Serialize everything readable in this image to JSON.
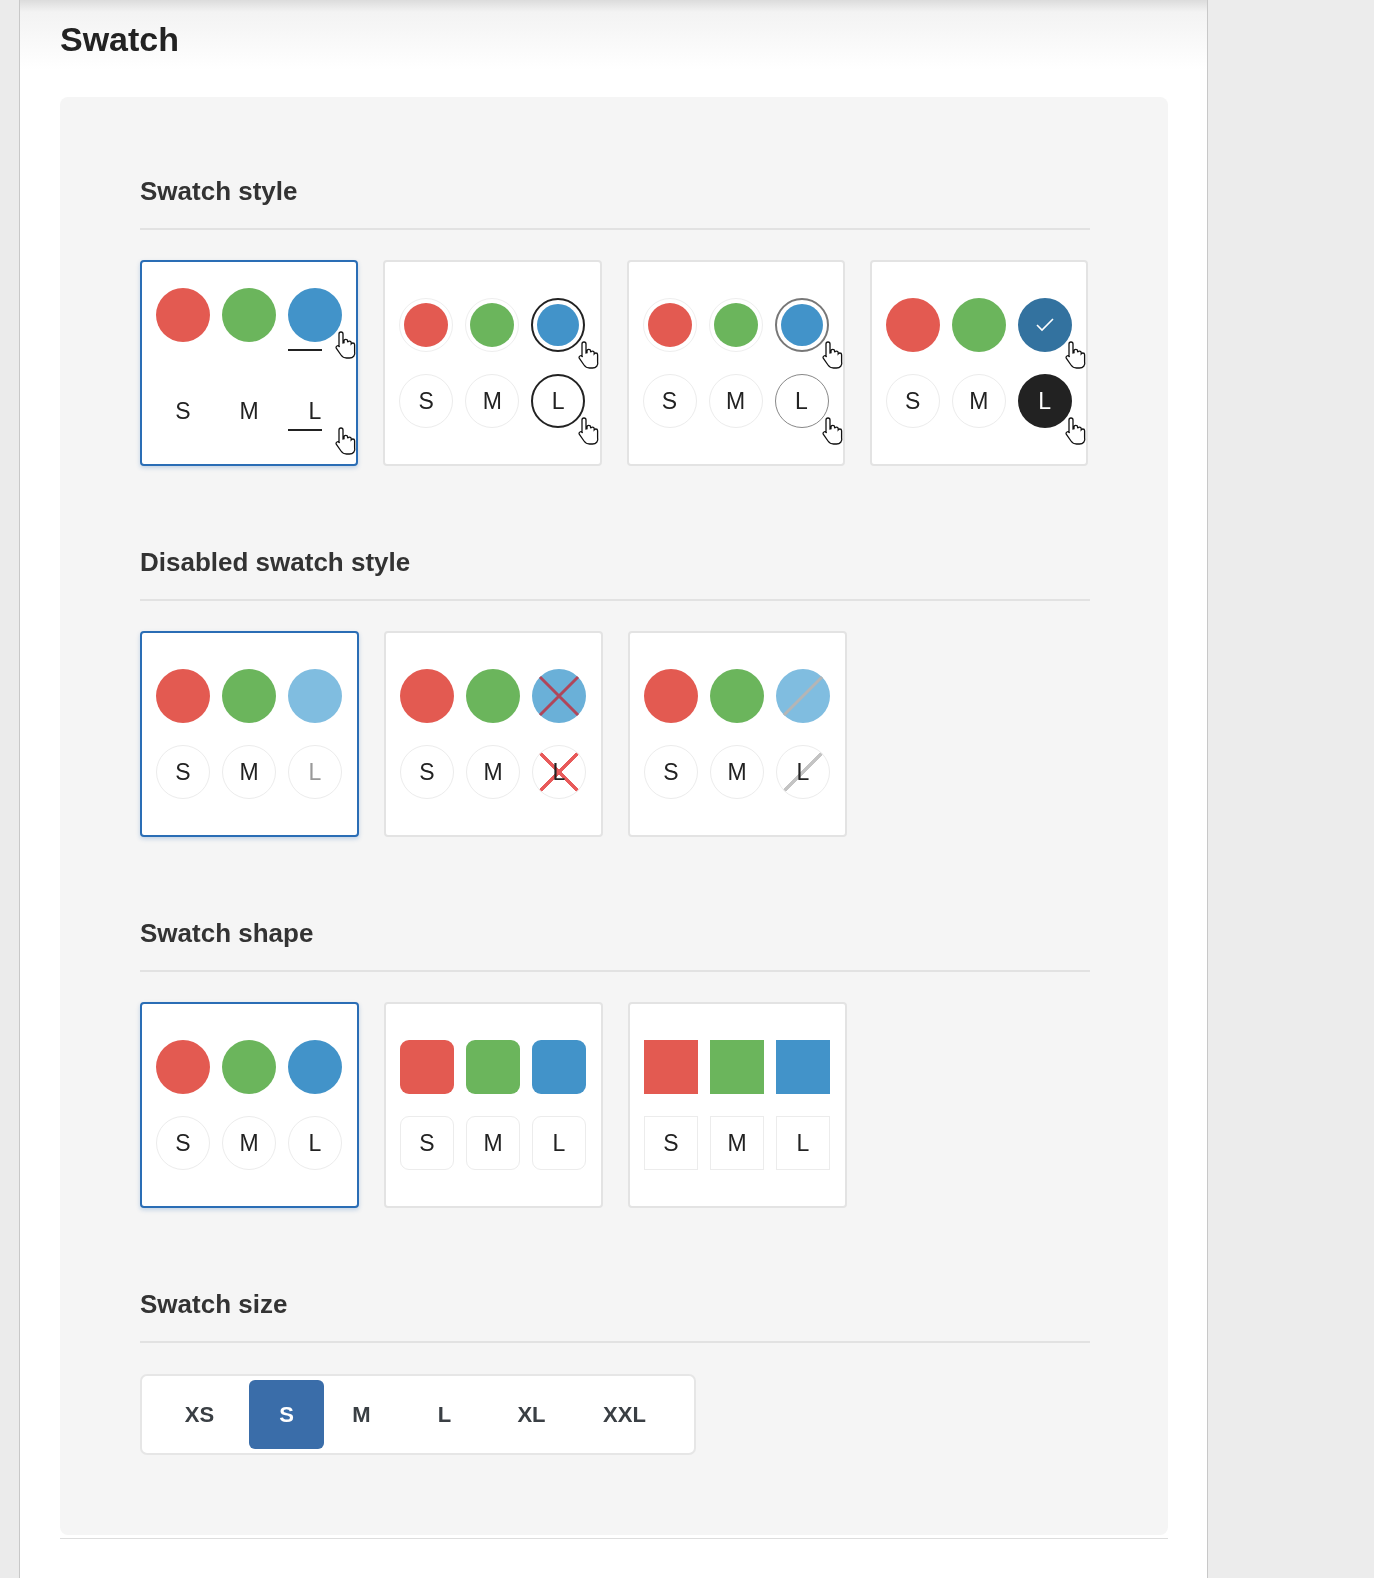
{
  "title": "Swatch",
  "sections": [
    {
      "heading": "Swatch style",
      "kind": "cards",
      "options": [
        {
          "kind": "underline",
          "selected": true,
          "colors": [
            {
              "color": "#e35a51",
              "active": false
            },
            {
              "color": "#6bb55c",
              "active": false
            },
            {
              "color": "#4293c9",
              "active": true
            }
          ],
          "sizes": [
            {
              "label": "S",
              "active": false
            },
            {
              "label": "M",
              "active": false
            },
            {
              "label": "L",
              "active": true
            }
          ]
        },
        {
          "kind": "ring-dark",
          "selected": false,
          "colors": [
            {
              "color": "#e35a51",
              "active": false
            },
            {
              "color": "#6bb55c",
              "active": false
            },
            {
              "color": "#4293c9",
              "active": true
            }
          ],
          "sizes": [
            {
              "label": "S",
              "active": false
            },
            {
              "label": "M",
              "active": false
            },
            {
              "label": "L",
              "active": true
            }
          ]
        },
        {
          "kind": "ring-light",
          "selected": false,
          "colors": [
            {
              "color": "#e35a51",
              "active": false
            },
            {
              "color": "#6bb55c",
              "active": false
            },
            {
              "color": "#4293c9",
              "active": true
            }
          ],
          "sizes": [
            {
              "label": "S",
              "active": false
            },
            {
              "label": "M",
              "active": false
            },
            {
              "label": "L",
              "active": true
            }
          ]
        },
        {
          "kind": "filled",
          "selected": false,
          "colors": [
            {
              "color": "#e35a51",
              "active": false
            },
            {
              "color": "#6bb55c",
              "active": false
            },
            {
              "color": "#33729f",
              "active": true
            }
          ],
          "sizes": [
            {
              "label": "S",
              "active": false
            },
            {
              "label": "M",
              "active": false
            },
            {
              "label": "L",
              "active": true
            }
          ]
        }
      ]
    },
    {
      "heading": "Disabled swatch style",
      "kind": "cards",
      "options": [
        {
          "kind": "faded",
          "selected": true,
          "colors": [
            {
              "color": "#e35a51"
            },
            {
              "color": "#6bb55c"
            },
            {
              "color": "#80bde0"
            }
          ],
          "sizes": [
            {
              "label": "S",
              "active": false
            },
            {
              "label": "M",
              "active": false
            },
            {
              "label": "L",
              "active": true
            }
          ]
        },
        {
          "kind": "cross",
          "selected": false,
          "colors": [
            {
              "color": "#e35a51",
              "active": false
            },
            {
              "color": "#6bb55c",
              "active": false
            },
            {
              "color": "#6ab0d8",
              "active": true
            }
          ],
          "sizes": [
            {
              "label": "S",
              "active": false
            },
            {
              "label": "M",
              "active": false
            },
            {
              "label": "L",
              "active": true
            }
          ]
        },
        {
          "kind": "slash",
          "selected": false,
          "colors": [
            {
              "color": "#e35a51",
              "active": false
            },
            {
              "color": "#6bb55c",
              "active": false
            },
            {
              "color": "#80bde0",
              "active": true
            }
          ],
          "sizes": [
            {
              "label": "S",
              "active": false
            },
            {
              "label": "M",
              "active": false
            },
            {
              "label": "L",
              "active": true
            }
          ]
        }
      ]
    },
    {
      "heading": "Swatch shape",
      "kind": "cards",
      "options": [
        {
          "kind": "circle",
          "selected": true,
          "colors": [
            {
              "color": "#e35a51"
            },
            {
              "color": "#6bb55c"
            },
            {
              "color": "#4293c9"
            }
          ],
          "sizes": [
            {
              "label": "S"
            },
            {
              "label": "M"
            },
            {
              "label": "L"
            }
          ]
        },
        {
          "kind": "rounded",
          "selected": false,
          "colors": [
            {
              "color": "#e35a51"
            },
            {
              "color": "#6bb55c"
            },
            {
              "color": "#4293c9"
            }
          ],
          "sizes": [
            {
              "label": "S"
            },
            {
              "label": "M"
            },
            {
              "label": "L"
            }
          ]
        },
        {
          "kind": "square",
          "selected": false,
          "colors": [
            {
              "color": "#e35a51"
            },
            {
              "color": "#6bb55c"
            },
            {
              "color": "#4293c9"
            }
          ],
          "sizes": [
            {
              "label": "S"
            },
            {
              "label": "M"
            },
            {
              "label": "L"
            }
          ]
        }
      ]
    },
    {
      "heading": "Swatch size",
      "kind": "segmented",
      "options": [
        {
          "label": "XS",
          "selected": false
        },
        {
          "label": "S",
          "selected": true
        },
        {
          "label": "M",
          "selected": false
        },
        {
          "label": "L",
          "selected": false
        },
        {
          "label": "XL",
          "selected": false
        },
        {
          "label": "XXL",
          "selected": false
        }
      ]
    }
  ]
}
